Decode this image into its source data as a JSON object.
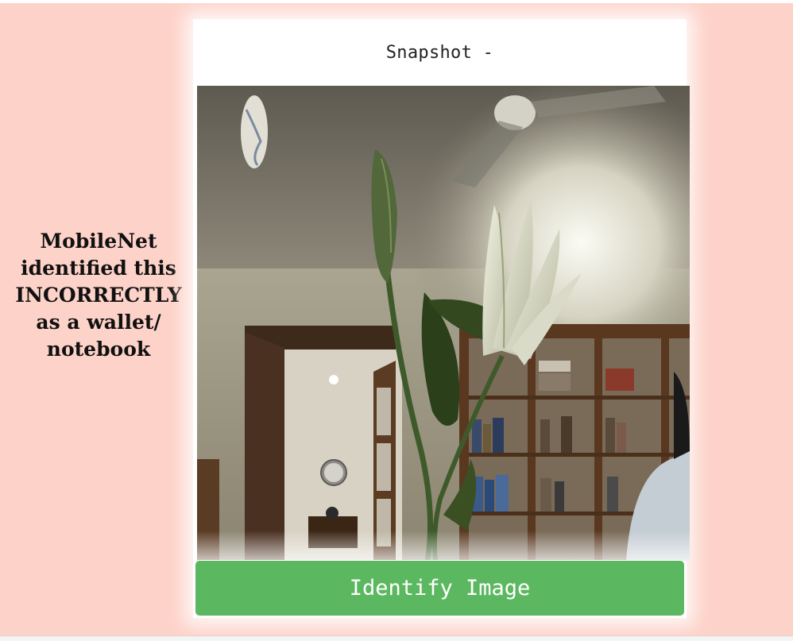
{
  "caption": {
    "text": "MobileNet identified this INCORRECTLY as a wallet/ notebook"
  },
  "card": {
    "title": "Snapshot -"
  },
  "snapshot": {
    "subject": "lily flowers with bud in vase, room with bookshelves, ceiling fan and wall clock"
  },
  "identify_button": {
    "label": "Identify Image",
    "color": "#5cb860"
  },
  "colors": {
    "page_background": "#fdd2c8",
    "card_background": "#ffffff"
  }
}
